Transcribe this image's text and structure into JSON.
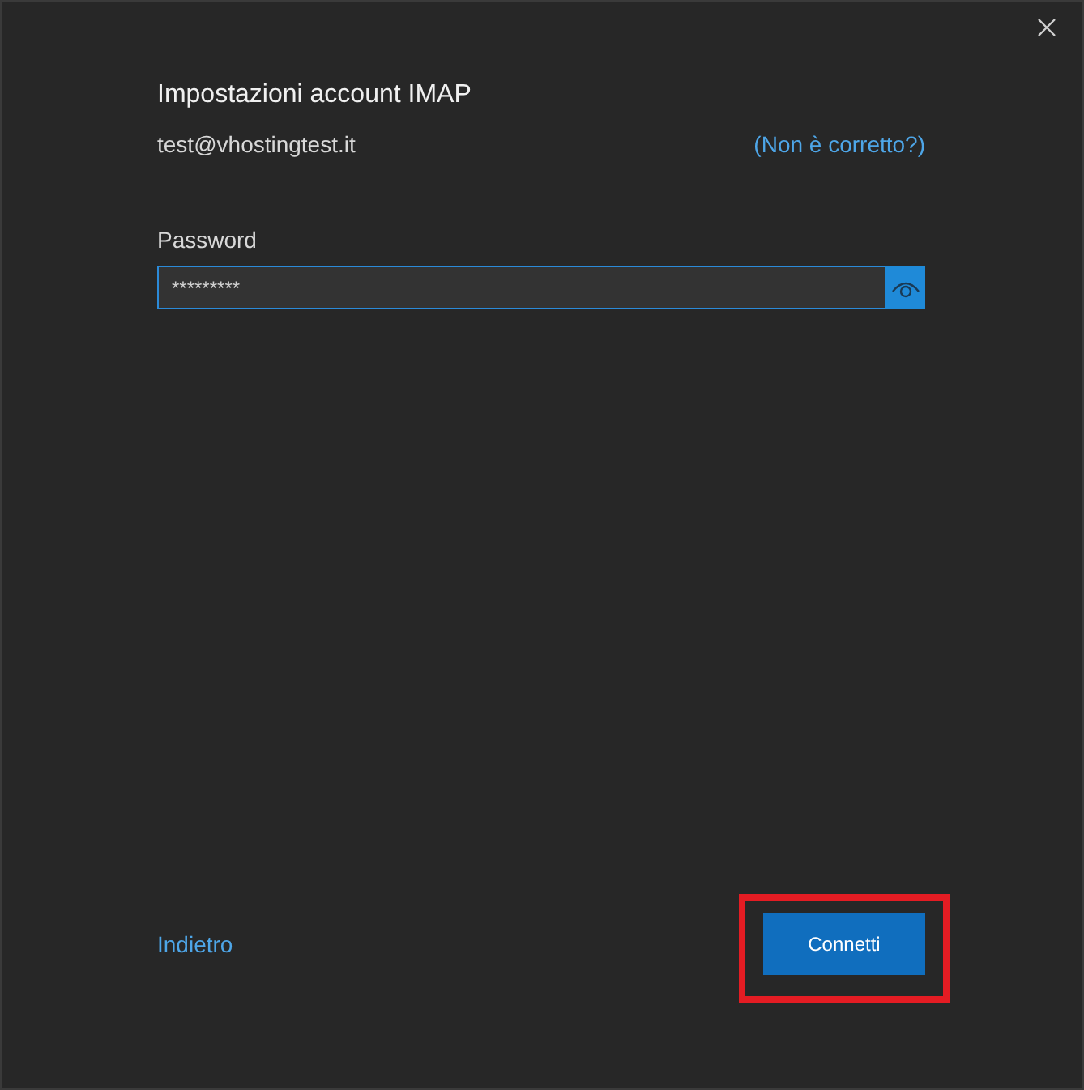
{
  "title": "Impostazioni account IMAP",
  "email": "test@vhostingtest.it",
  "wrong_link": "(Non è corretto?)",
  "password": {
    "label": "Password",
    "value": "*********",
    "focused": true
  },
  "back_link": "Indietro",
  "connect_button": {
    "label": "Connetti",
    "highlighted": true
  }
}
